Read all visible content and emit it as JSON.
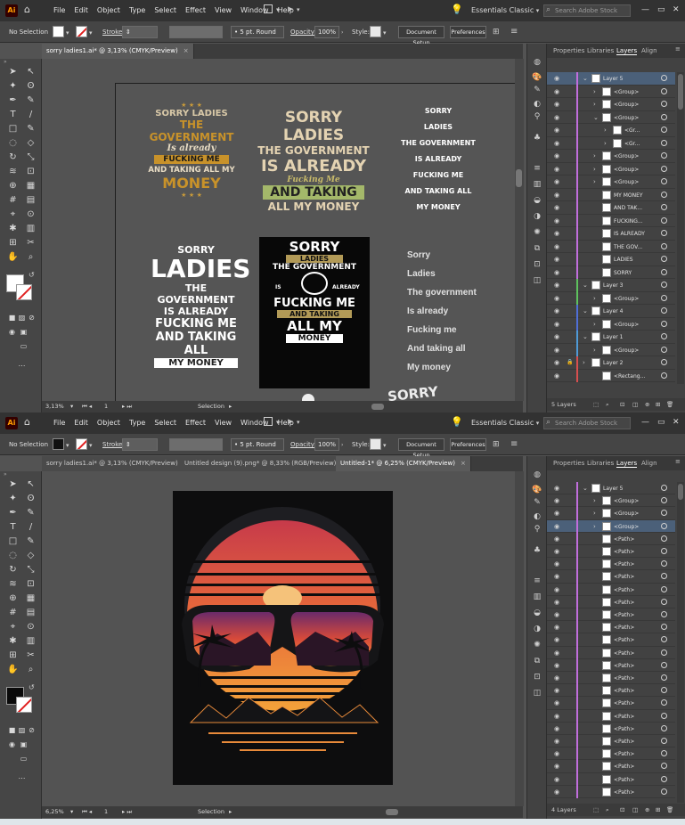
{
  "top": {
    "menubar": {
      "app_logo": "Ai",
      "menus": [
        "File",
        "Edit",
        "Object",
        "Type",
        "Select",
        "Effect",
        "View",
        "Window",
        "Help"
      ],
      "workspace": "Essentials Classic",
      "search_placeholder": "Search Adobe Stock"
    },
    "control": {
      "selection": "No Selection",
      "stroke_label": "Stroke:",
      "brush": "5 pt. Round",
      "opacity_label": "Opacity:",
      "opacity": "100%",
      "style_label": "Style:",
      "doc_setup": "Document Setup",
      "preferences": "Preferences"
    },
    "tabs": [
      {
        "label": "sorry ladies1.ai* @ 3,13% (CMYK/Preview)",
        "close": "×"
      }
    ],
    "status": {
      "zoom": "3,13%",
      "page": "1",
      "tool": "Selection"
    },
    "panel_tabs": [
      "Properties",
      "Libraries",
      "Layers",
      "Align"
    ],
    "layers": [
      {
        "name": "Layer 5",
        "indent": 0,
        "twirl": "v",
        "color": "#c06edc",
        "sel": true
      },
      {
        "name": "<Group>",
        "indent": 1,
        "twirl": ">",
        "color": "#c06edc"
      },
      {
        "name": "<Group>",
        "indent": 1,
        "twirl": ">",
        "color": "#c06edc"
      },
      {
        "name": "<Group>",
        "indent": 1,
        "twirl": "v",
        "color": "#c06edc"
      },
      {
        "name": "<Gr...",
        "indent": 2,
        "twirl": ">",
        "color": "#c06edc"
      },
      {
        "name": "<Gr...",
        "indent": 2,
        "twirl": ">",
        "color": "#c06edc"
      },
      {
        "name": "<Group>",
        "indent": 1,
        "twirl": ">",
        "color": "#c06edc"
      },
      {
        "name": "<Group>",
        "indent": 1,
        "twirl": ">",
        "color": "#c06edc"
      },
      {
        "name": "<Group>",
        "indent": 1,
        "twirl": ">",
        "color": "#c06edc"
      },
      {
        "name": "MY MONEY",
        "indent": 1,
        "twirl": "",
        "color": "#c06edc"
      },
      {
        "name": "AND TAK...",
        "indent": 1,
        "twirl": "",
        "color": "#c06edc"
      },
      {
        "name": "FUCKING...",
        "indent": 1,
        "twirl": "",
        "color": "#c06edc"
      },
      {
        "name": "IS ALREADY",
        "indent": 1,
        "twirl": "",
        "color": "#c06edc"
      },
      {
        "name": "THE GOV...",
        "indent": 1,
        "twirl": "",
        "color": "#c06edc"
      },
      {
        "name": "LADIES",
        "indent": 1,
        "twirl": "",
        "color": "#c06edc"
      },
      {
        "name": "SORRY",
        "indent": 1,
        "twirl": "",
        "color": "#c06edc"
      },
      {
        "name": "Layer 3",
        "indent": 0,
        "twirl": "v",
        "color": "#5ec15e"
      },
      {
        "name": "<Group>",
        "indent": 1,
        "twirl": ">",
        "color": "#5ec15e"
      },
      {
        "name": "Layer 4",
        "indent": 0,
        "twirl": "v",
        "color": "#4f6fd6"
      },
      {
        "name": "<Group>",
        "indent": 1,
        "twirl": ">",
        "color": "#4f6fd6"
      },
      {
        "name": "Layer 1",
        "indent": 0,
        "twirl": "v",
        "color": "#4f9ad6"
      },
      {
        "name": "<Group>",
        "indent": 1,
        "twirl": ">",
        "color": "#4f9ad6"
      },
      {
        "name": "Layer 2",
        "indent": 0,
        "twirl": ">",
        "color": "#d64f4f",
        "lock": true
      },
      {
        "name": "<Rectang...",
        "indent": 1,
        "twirl": "",
        "color": "#d64f4f"
      }
    ],
    "layer_count": "5 Layers",
    "designs": {
      "d1": {
        "l1": "SORRY LADIES",
        "l2": "THE GOVERNMENT",
        "l3": "Is already",
        "l4": "FUCKING ME",
        "l5": "AND TAKING ALL MY",
        "l6": "MONEY"
      },
      "d2": {
        "l1": "SORRY LADIES",
        "l2": "THE GOVERNMENT",
        "l3": "IS ALREADY",
        "l4": "Fucking Me",
        "l5": "AND TAKING",
        "l6": "ALL MY MONEY"
      },
      "d3": {
        "l1": "SORRY",
        "l2": "LADIES",
        "l3": "THE GOVERNMENT",
        "l4": "IS ALREADY",
        "l5": "FUCKING ME",
        "l6": "AND TAKING ALL",
        "l7": "MY MONEY"
      },
      "d4": {
        "l1": "SORRY",
        "l2": "LADIES",
        "l3": "THE GOVERNMENT",
        "l4": "IS ALREADY",
        "l5": "FUCKING ME",
        "l6": "AND TAKING ALL",
        "l7": "MY MONEY"
      },
      "d5": {
        "l1": "SORRY",
        "l2": "LADIES",
        "l3": "THE GOVERNMENT",
        "l4": "IS",
        "l5": "ALREADY",
        "l6": "FUCKING ME",
        "l7": "AND TAKING",
        "l8": "ALL MY",
        "l9": "MONEY"
      },
      "d6": {
        "l1": "Sorry",
        "l2": "Ladies",
        "l3": "The government",
        "l4": "Is already",
        "l5": "Fucking me",
        "l6": "And taking all",
        "l7": "My money"
      },
      "d7": {
        "l1": "SORRY LADIES"
      }
    }
  },
  "bottom": {
    "menubar": {
      "app_logo": "Ai",
      "menus": [
        "File",
        "Edit",
        "Object",
        "Type",
        "Select",
        "Effect",
        "View",
        "Window",
        "Help"
      ],
      "workspace": "Essentials Classic",
      "search_placeholder": "Search Adobe Stock"
    },
    "control": {
      "selection": "No Selection",
      "stroke_label": "Stroke:",
      "brush": "5 pt. Round",
      "opacity_label": "Opacity:",
      "opacity": "100%",
      "style_label": "Style:",
      "doc_setup": "Document Setup",
      "preferences": "Preferences"
    },
    "tabs": [
      {
        "label": "sorry ladies1.ai* @ 3,13% (CMYK/Preview)",
        "close": "×"
      },
      {
        "label": "Untitled design (9).png* @ 8,33% (RGB/Preview)",
        "close": "×"
      },
      {
        "label": "Untitled-1* @ 6,25% (CMYK/Preview)",
        "close": "×"
      }
    ],
    "status": {
      "zoom": "6,25%",
      "page": "1",
      "tool": "Selection"
    },
    "panel_tabs": [
      "Properties",
      "Libraries",
      "Layers",
      "Align"
    ],
    "layers": [
      {
        "name": "Layer 5",
        "indent": 0,
        "twirl": "v",
        "color": "#c06edc"
      },
      {
        "name": "<Group>",
        "indent": 1,
        "twirl": ">",
        "color": "#c06edc"
      },
      {
        "name": "<Group>",
        "indent": 1,
        "twirl": ">",
        "color": "#c06edc"
      },
      {
        "name": "<Group>",
        "indent": 1,
        "twirl": ">",
        "color": "#c06edc",
        "sel": true
      },
      {
        "name": "<Path>",
        "indent": 1,
        "twirl": "",
        "color": "#c06edc"
      },
      {
        "name": "<Path>",
        "indent": 1,
        "twirl": "",
        "color": "#c06edc"
      },
      {
        "name": "<Path>",
        "indent": 1,
        "twirl": "",
        "color": "#c06edc"
      },
      {
        "name": "<Path>",
        "indent": 1,
        "twirl": "",
        "color": "#c06edc"
      },
      {
        "name": "<Path>",
        "indent": 1,
        "twirl": "",
        "color": "#c06edc"
      },
      {
        "name": "<Path>",
        "indent": 1,
        "twirl": "",
        "color": "#c06edc"
      },
      {
        "name": "<Path>",
        "indent": 1,
        "twirl": "",
        "color": "#c06edc"
      },
      {
        "name": "<Path>",
        "indent": 1,
        "twirl": "",
        "color": "#c06edc"
      },
      {
        "name": "<Path>",
        "indent": 1,
        "twirl": "",
        "color": "#c06edc"
      },
      {
        "name": "<Path>",
        "indent": 1,
        "twirl": "",
        "color": "#c06edc"
      },
      {
        "name": "<Path>",
        "indent": 1,
        "twirl": "",
        "color": "#c06edc"
      },
      {
        "name": "<Path>",
        "indent": 1,
        "twirl": "",
        "color": "#c06edc"
      },
      {
        "name": "<Path>",
        "indent": 1,
        "twirl": "",
        "color": "#c06edc"
      },
      {
        "name": "<Path>",
        "indent": 1,
        "twirl": "",
        "color": "#c06edc"
      },
      {
        "name": "<Path>",
        "indent": 1,
        "twirl": "",
        "color": "#c06edc"
      },
      {
        "name": "<Path>",
        "indent": 1,
        "twirl": "",
        "color": "#c06edc"
      },
      {
        "name": "<Path>",
        "indent": 1,
        "twirl": "",
        "color": "#c06edc"
      },
      {
        "name": "<Path>",
        "indent": 1,
        "twirl": "",
        "color": "#c06edc"
      },
      {
        "name": "<Path>",
        "indent": 1,
        "twirl": "",
        "color": "#c06edc"
      },
      {
        "name": "<Path>",
        "indent": 1,
        "twirl": "",
        "color": "#c06edc"
      },
      {
        "name": "<Path>",
        "indent": 1,
        "twirl": "",
        "color": "#c06edc"
      }
    ],
    "layer_count": "4 Layers"
  }
}
